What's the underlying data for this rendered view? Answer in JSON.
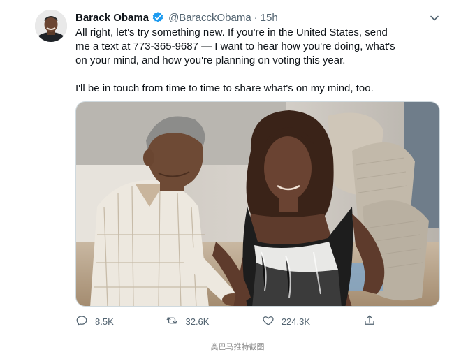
{
  "tweet": {
    "author_name": "Barack Obama",
    "handle": "@BaracckObama",
    "separator": "·",
    "time": "15h",
    "text_p1": "All right, let's try something new. If you're in the United States, send\nme a text at 773-365-9687 — I want to hear how you're doing, what's\non your mind, and how you're planning on voting this year.",
    "text_p2": "I'll be in touch from time to time to share what's on my mind, too.",
    "verified_color": "#1d9bf0"
  },
  "actions": {
    "reply_count": "8.5K",
    "retweet_count": "32.6K",
    "like_count": "224.3K"
  },
  "caption": "奥巴马推特截图",
  "icons": {
    "caret": "chevron-down-icon",
    "reply": "reply-icon",
    "retweet": "retweet-icon",
    "like": "heart-icon",
    "share": "share-icon",
    "verified": "verified-badge-icon"
  }
}
